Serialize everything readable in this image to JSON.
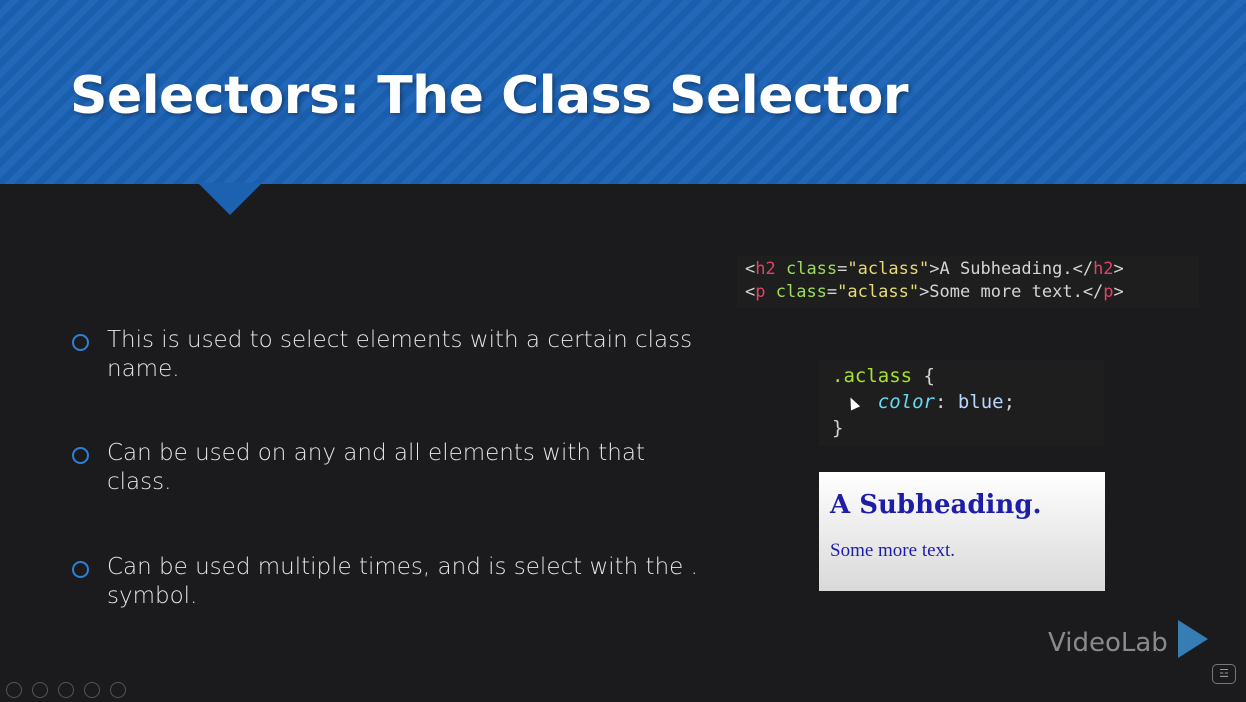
{
  "slide": {
    "title": "Selectors: The Class Selector",
    "bullets": [
      "This is used to select elements with a certain class name.",
      "Can be used on any and all elements with that class.",
      "Can be used multiple times, and is select with the . symbol."
    ]
  },
  "code_html": {
    "line1": {
      "open_lt": "<",
      "tag": "h2",
      "attr": " class",
      "eq": "=",
      "val": "\"aclass\"",
      "content": ">A Subheading.</",
      "close_tag": "h2",
      "gt": ">"
    },
    "line2": {
      "open_lt": "<",
      "tag": "p",
      "attr": " class",
      "eq": "=",
      "val": "\"aclass\"",
      "content": ">Some more text.</",
      "close_tag": "p",
      "gt": ">"
    }
  },
  "code_css": {
    "selector": ".aclass",
    "open_brace": " {",
    "property": "color",
    "colon": ": ",
    "value": "blue",
    "semicolon": ";",
    "close_brace": "}"
  },
  "preview": {
    "heading": "A Subheading.",
    "paragraph": "Some more text."
  },
  "logo": {
    "text": "VideoLab"
  },
  "corner_icon": "fcc-icon",
  "colors": {
    "header_blue": "#1a5fae",
    "bullet_marker": "#2f7fd4",
    "preview_text": "#1d1da8"
  }
}
